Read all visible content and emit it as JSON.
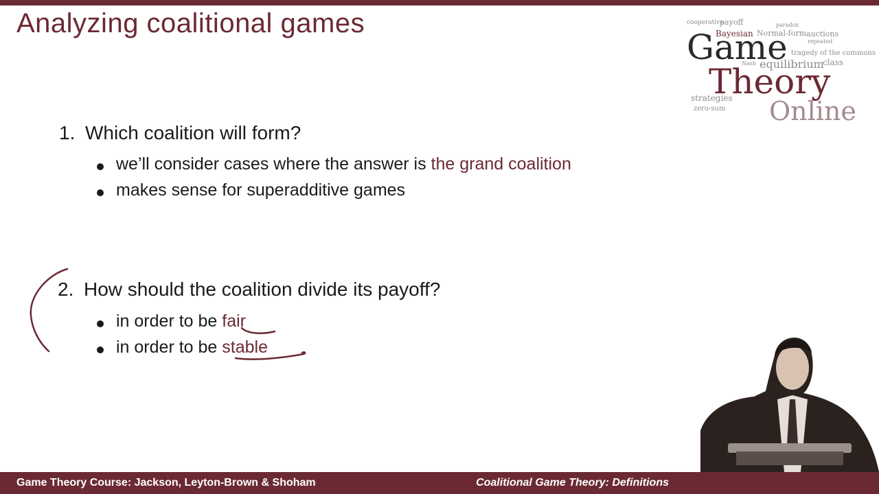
{
  "slide": {
    "title": "Analyzing coalitional games",
    "q1": {
      "number": "1.",
      "text": "Which coalition will form?",
      "bullets": [
        {
          "pre": "we’ll consider cases where the answer is ",
          "accent": "the grand coalition"
        },
        {
          "pre": "makes sense for superadditive games",
          "accent": ""
        }
      ]
    },
    "q2": {
      "number": "2.",
      "text": "How should the coalition divide its payoff?",
      "bullets": [
        {
          "pre": "in order to be ",
          "accent": "fair"
        },
        {
          "pre": "in order to be ",
          "accent": "stable"
        }
      ]
    }
  },
  "logo": {
    "line1": "Game",
    "line2": "Theory",
    "line3": "Online",
    "cloud_words": [
      "cooperative",
      "payoff",
      "Bayesian",
      "Normal-form",
      "auctions",
      "paradox",
      "repeated",
      "tragedy of the commons",
      "equilibrium",
      "class",
      "Nash",
      "strategies",
      "zero-sum"
    ]
  },
  "footer": {
    "left": "Game Theory Course: Jackson, Leyton-Brown & Shoham",
    "right": "Coalitional Game Theory: Definitions"
  },
  "colors": {
    "accent": "#6b2a33",
    "text": "#1a1a1a",
    "footer_bg": "#6b2a33"
  }
}
